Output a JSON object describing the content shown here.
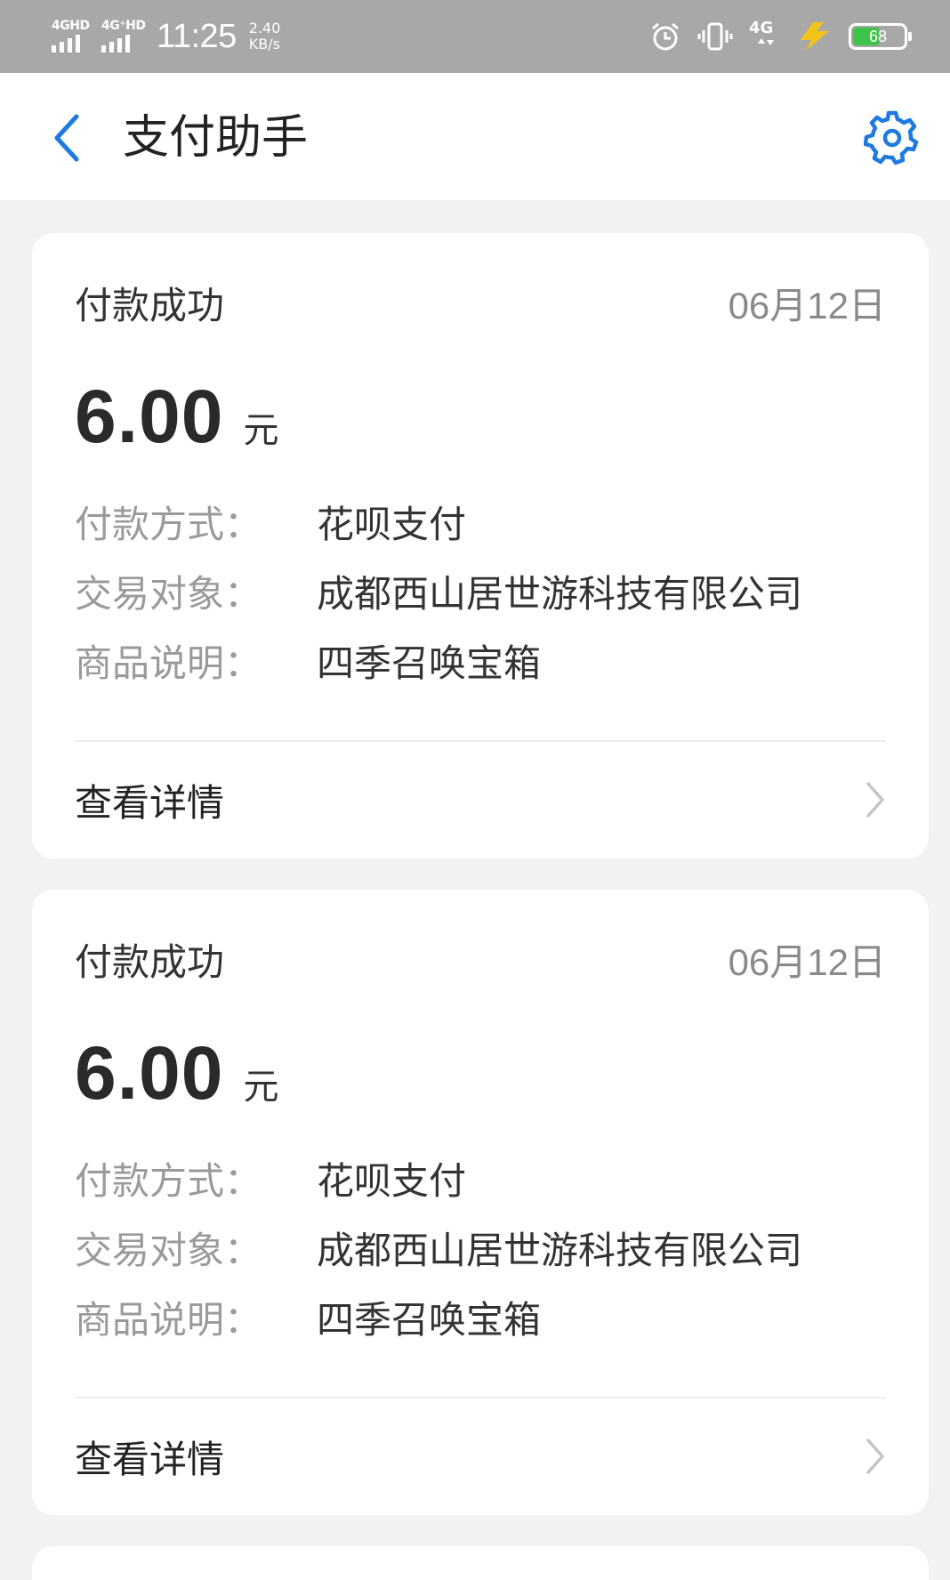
{
  "status_bar": {
    "signal1_label": "4GHD",
    "signal2_label": "4G⁺HD",
    "time": "11:25",
    "speed_value": "2.40",
    "speed_unit": "KB/s",
    "network_label": "4G",
    "battery_level": "68"
  },
  "header": {
    "title": "支付助手",
    "back_icon": "chevron-left-icon",
    "settings_icon": "gear-icon"
  },
  "colors": {
    "accent": "#1f7ae0",
    "status_bar_bg": "#a8a8a8",
    "battery_fill": "#3fc24a",
    "charging_bolt": "#f2c318"
  },
  "cards": [
    {
      "status": "付款成功",
      "date": "06月12日",
      "amount": "6.00",
      "unit": "元",
      "fields": [
        {
          "label": "付款方式：",
          "value": "花呗支付"
        },
        {
          "label": "交易对象：",
          "value": "成都西山居世游科技有限公司"
        },
        {
          "label": "商品说明：",
          "value": "四季召唤宝箱"
        }
      ],
      "detail_label": "查看详情"
    },
    {
      "status": "付款成功",
      "date": "06月12日",
      "amount": "6.00",
      "unit": "元",
      "fields": [
        {
          "label": "付款方式：",
          "value": "花呗支付"
        },
        {
          "label": "交易对象：",
          "value": "成都西山居世游科技有限公司"
        },
        {
          "label": "商品说明：",
          "value": "四季召唤宝箱"
        }
      ],
      "detail_label": "查看详情"
    }
  ]
}
